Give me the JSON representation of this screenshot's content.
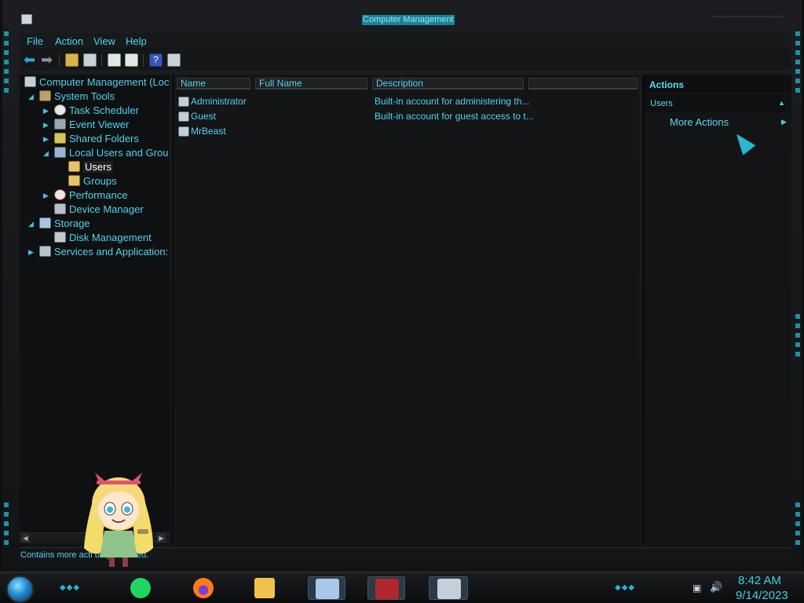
{
  "window": {
    "title": "Computer Management"
  },
  "menu": [
    "File",
    "Action",
    "View",
    "Help"
  ],
  "toolbar": {
    "icons": [
      "back-icon",
      "forward-icon",
      "up-folder-icon",
      "show-hide-tree-icon",
      "refresh-icon",
      "export-list-icon",
      "help-icon",
      "show-hide-action-pane-icon"
    ]
  },
  "tree": {
    "items": [
      {
        "label": "Computer Management (Loc",
        "icon": "computer-icon",
        "level": 0,
        "expanded": true
      },
      {
        "label": "System Tools",
        "icon": "tools-icon",
        "level": 1,
        "expanded": true
      },
      {
        "label": "Task Scheduler",
        "icon": "clock-icon",
        "level": 2,
        "expanded": false
      },
      {
        "label": "Event Viewer",
        "icon": "event-viewer-icon",
        "level": 2,
        "expanded": false
      },
      {
        "label": "Shared Folders",
        "icon": "shared-folder-icon",
        "level": 2,
        "expanded": false
      },
      {
        "label": "Local Users and Grou",
        "icon": "users-icon",
        "level": 2,
        "expanded": true
      },
      {
        "label": "Users",
        "icon": "folder-icon",
        "level": 3,
        "selected": true
      },
      {
        "label": "Groups",
        "icon": "folder-icon",
        "level": 3
      },
      {
        "label": "Performance",
        "icon": "performance-icon",
        "level": 2,
        "expanded": false
      },
      {
        "label": "Device Manager",
        "icon": "device-manager-icon",
        "level": 2
      },
      {
        "label": "Storage",
        "icon": "storage-icon",
        "level": 1,
        "expanded": true
      },
      {
        "label": "Disk Management",
        "icon": "disk-icon",
        "level": 2
      },
      {
        "label": "Services and Application:",
        "icon": "services-icon",
        "level": 1,
        "expanded": false
      }
    ]
  },
  "list": {
    "columns": [
      "Name",
      "Full Name",
      "Description",
      ""
    ],
    "rows": [
      {
        "name": "Administrator",
        "full_name": "",
        "description": "Built-in account for administering th..."
      },
      {
        "name": "Guest",
        "full_name": "",
        "description": "Built-in account for guest access to t..."
      },
      {
        "name": "MrBeast",
        "full_name": "",
        "description": ""
      }
    ]
  },
  "actions": {
    "header": "Actions",
    "section": "Users",
    "items": [
      {
        "label": "More Actions"
      }
    ]
  },
  "status": {
    "text": "Contains more acti                    be performed."
  },
  "taskbar": {
    "apps": [
      "spotify-icon",
      "firefox-icon",
      "file-explorer-icon",
      "app-window-icon",
      "media-app-icon",
      "computer-management-icon"
    ],
    "time": "8:42 AM",
    "date": "9/14/2023"
  },
  "colors": {
    "accent": "#4fd3ee",
    "background": "#141517",
    "frame": "#1b1d20"
  }
}
